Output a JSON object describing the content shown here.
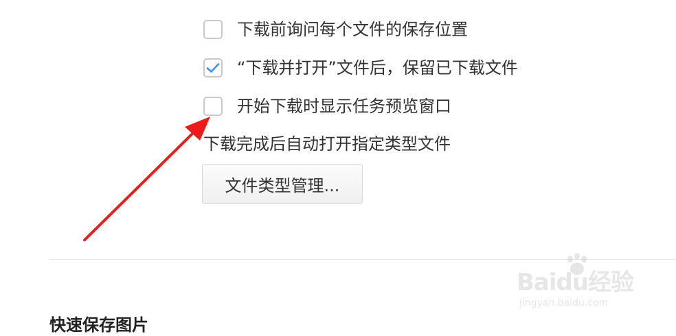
{
  "options": [
    {
      "label": "下载前询问每个文件的保存位置",
      "checked": false
    },
    {
      "label": "“下载并打开”文件后，保留已下载文件",
      "checked": true
    },
    {
      "label": "开始下载时显示任务预览窗口",
      "checked": false
    }
  ],
  "auto_open_text": "下载完成后自动打开指定类型文件",
  "file_type_button_label": "文件类型管理...",
  "next_section": {
    "title": "快速保存图片"
  },
  "colors": {
    "check_mark": "#3b8ff5",
    "checkbox_border": "#c9c9c9",
    "arrow": "#ee1b1b",
    "text": "#333333"
  },
  "watermark": {
    "brand": "Baidu经验",
    "url": "jingyan.baidu.com"
  }
}
